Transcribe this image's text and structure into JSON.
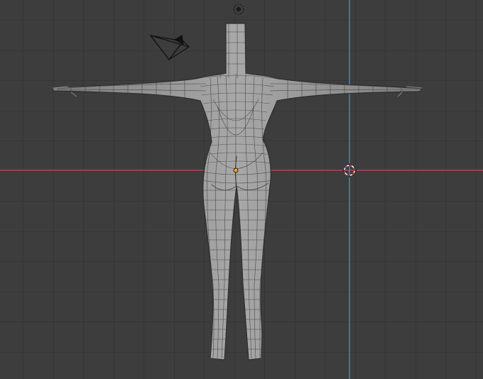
{
  "viewport": {
    "background": "#3d3d3d",
    "grid_color": "#2f2f2f",
    "x_axis_color": "#b04a55",
    "z_axis_color": "#4f86c6",
    "mesh_fill": "#9a9a9a",
    "mesh_wire": "#3a3a3a",
    "origin_color": "#f0a030"
  },
  "objects": {
    "mesh": "character-body-mesh",
    "camera": "camera-icon",
    "light": "light-icon",
    "cursor": "3d-cursor-icon"
  }
}
